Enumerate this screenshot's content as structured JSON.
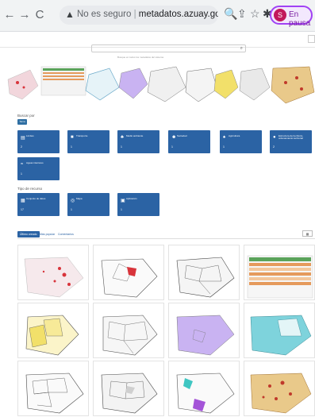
{
  "browser": {
    "insecure_label": "No es seguro",
    "url": "metadatos.azuay.gob.ec/geo...",
    "profile_initial": "S",
    "profile_status": "En pausa"
  },
  "site": {
    "search_hint": "Busque en todos los metadatos del sistema"
  },
  "filters": {
    "search_by_label": "Buscar por",
    "chip_label": "Tema",
    "resource_type_label": "Tipo de recurso"
  },
  "categories": [
    {
      "label": "Límites",
      "icon": "map-icon",
      "count": "2"
    },
    {
      "label": "Transporte",
      "icon": "car-icon",
      "count": "1"
    },
    {
      "label": "Medio ambiente",
      "icon": "leaf-icon",
      "count": "1"
    },
    {
      "label": "Sociedad",
      "icon": "people-icon",
      "count": "1"
    },
    {
      "label": "Agricultura",
      "icon": "tree-icon",
      "count": "1"
    },
    {
      "label": "Estructura del territorio, ordenamiento territorial",
      "icon": "globe-icon",
      "count": "2"
    },
    {
      "label": "Aguas interiores",
      "icon": "water-icon",
      "count": "1"
    }
  ],
  "resource_types": [
    {
      "label": "Conjunto de datos",
      "icon": "dataset-icon",
      "count": "17"
    },
    {
      "label": "Mapa",
      "icon": "map-icon",
      "count": "1"
    },
    {
      "label": "Aplicación",
      "icon": "app-icon",
      "count": "1"
    }
  ],
  "results_tabs": [
    "Último creado",
    "Más popular",
    "Comentarios"
  ],
  "colors": {
    "primary": "#2b63a4",
    "profile_border": "#a142f4",
    "map_fill_purple": "#c9b3f2",
    "map_fill_orange": "#e9c98a",
    "map_fill_teal": "#7ed3dc",
    "map_fill_yellow": "#f2e06a",
    "map_fill_red": "#d8343b"
  }
}
